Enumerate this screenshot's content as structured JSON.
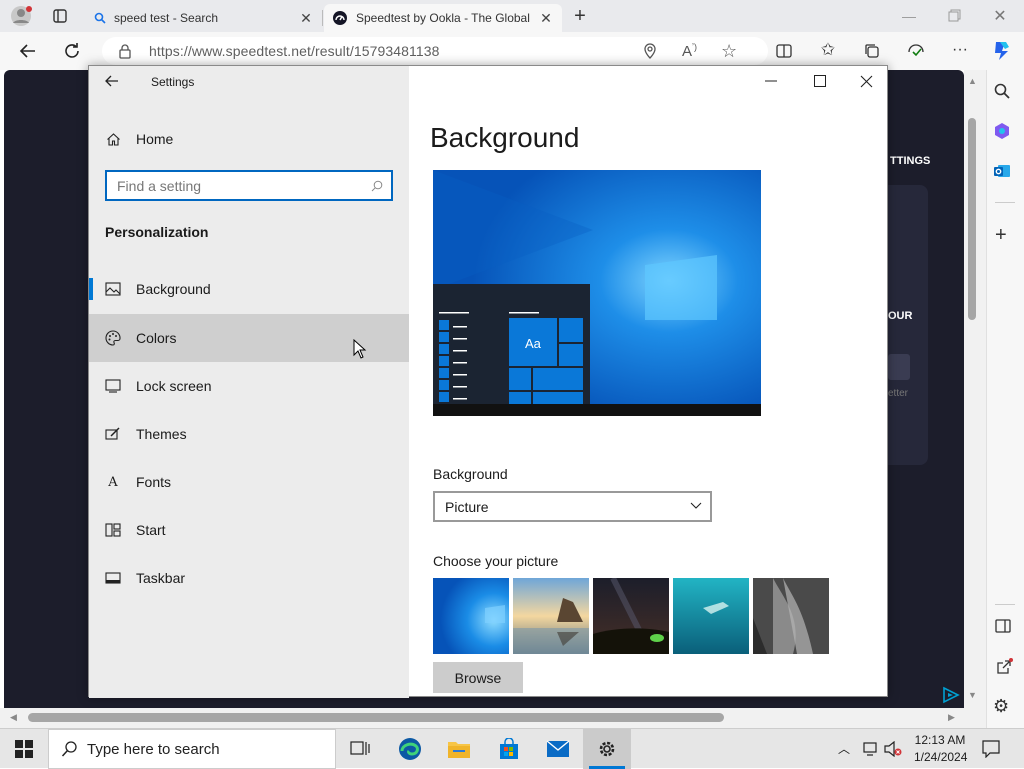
{
  "browser": {
    "tabs": [
      {
        "title": "speed test - Search",
        "active": false
      },
      {
        "title": "Speedtest by Ookla - The Global",
        "active": true
      }
    ],
    "url": "https://www.speedtest.net/result/15793481138"
  },
  "page_fragments": {
    "settings_text": "TTINGS",
    "our_text": "OUR",
    "etter_text": "etter"
  },
  "settings": {
    "window_title": "Settings",
    "home_label": "Home",
    "search_placeholder": "Find a setting",
    "section_title": "Personalization",
    "nav_items": [
      {
        "label": "Background",
        "icon": "picture-icon",
        "selected": true
      },
      {
        "label": "Colors",
        "icon": "palette-icon",
        "hovered": true
      },
      {
        "label": "Lock screen",
        "icon": "lock-screen-icon"
      },
      {
        "label": "Themes",
        "icon": "themes-brush-icon"
      },
      {
        "label": "Fonts",
        "icon": "fonts-icon"
      },
      {
        "label": "Start",
        "icon": "start-icon"
      },
      {
        "label": "Taskbar",
        "icon": "taskbar-icon"
      }
    ],
    "page_title": "Background",
    "preview_tile_text": "Aa",
    "background_label": "Background",
    "background_value": "Picture",
    "choose_picture_label": "Choose your picture",
    "browse_label": "Browse"
  },
  "taskbar": {
    "search_placeholder": "Type here to search",
    "time": "12:13 AM",
    "date": "1/24/2024"
  },
  "colors": {
    "accent": "#0078d4",
    "settings_left_pane": "#ececec",
    "page_dark": "#1c1d2b"
  }
}
